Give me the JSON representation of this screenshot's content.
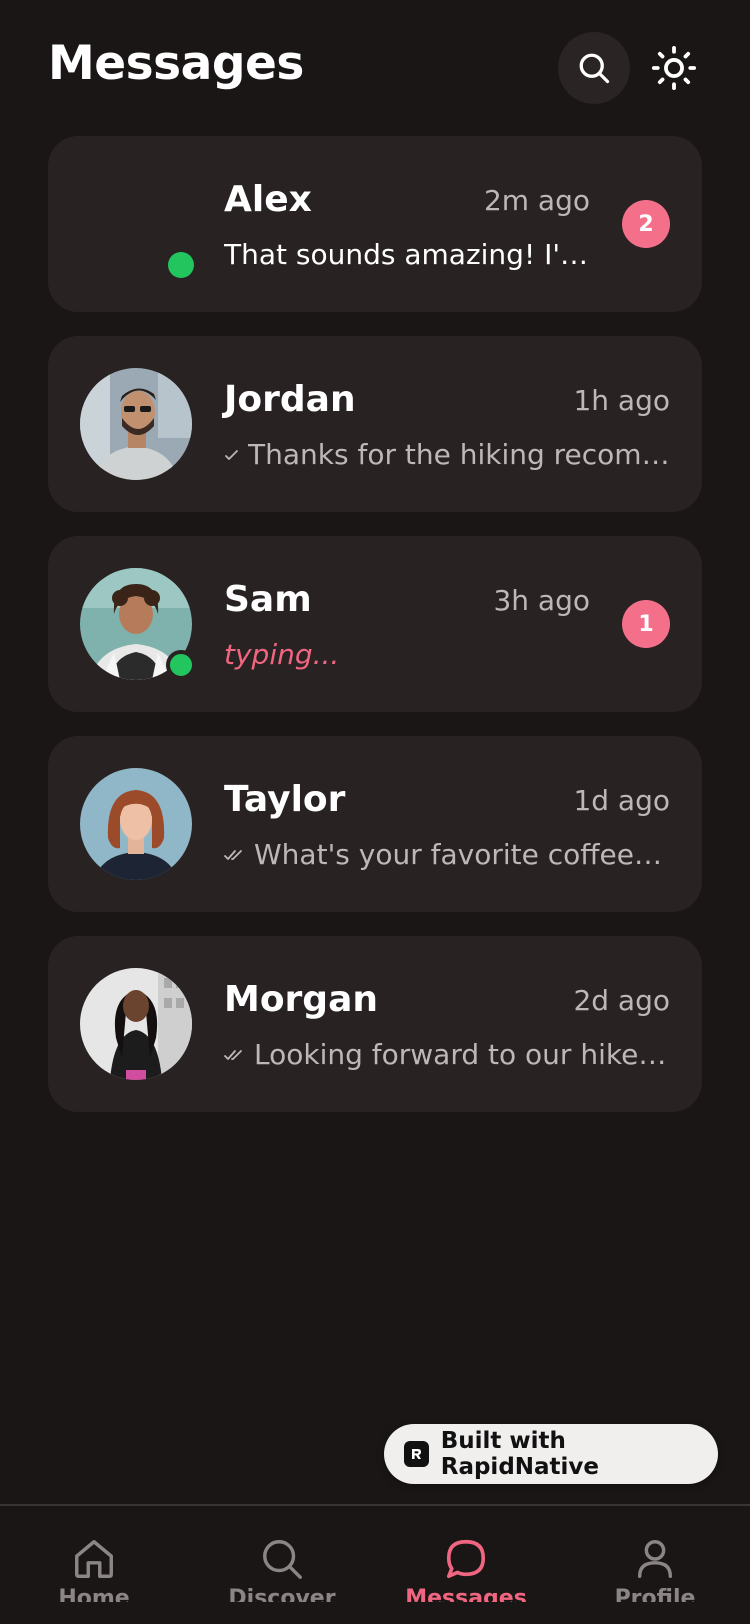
{
  "header": {
    "title": "Messages",
    "search_icon": "search-icon",
    "theme_icon": "sun-icon"
  },
  "conversations": [
    {
      "name": "Alex",
      "time": "2m ago",
      "preview": "That sounds amazing! I'd l...",
      "unread": "2",
      "online": true,
      "status": "unread"
    },
    {
      "name": "Jordan",
      "time": "1h ago",
      "preview": "Thanks for the hiking recomm...",
      "status": "sent"
    },
    {
      "name": "Sam",
      "time": "3h ago",
      "preview": "typing...",
      "unread": "1",
      "online": true,
      "status": "typing"
    },
    {
      "name": "Taylor",
      "time": "1d ago",
      "preview": "What's your favorite coffee sp...",
      "status": "read"
    },
    {
      "name": "Morgan",
      "time": "2d ago",
      "preview": "Looking forward to our hike t...",
      "status": "read"
    }
  ],
  "built_with": {
    "label": "Built with RapidNative"
  },
  "tabs": [
    {
      "label": "Home",
      "icon": "home-icon"
    },
    {
      "label": "Discover",
      "icon": "search-icon"
    },
    {
      "label": "Messages",
      "icon": "chat-bubble-icon",
      "active": true
    },
    {
      "label": "Profile",
      "icon": "user-icon"
    }
  ],
  "colors": {
    "background": "#1b1616",
    "card": "#282222",
    "accent": "#f06680",
    "badge": "#f4708a",
    "online": "#22c55e",
    "muted_text": "#bdb7b7"
  }
}
